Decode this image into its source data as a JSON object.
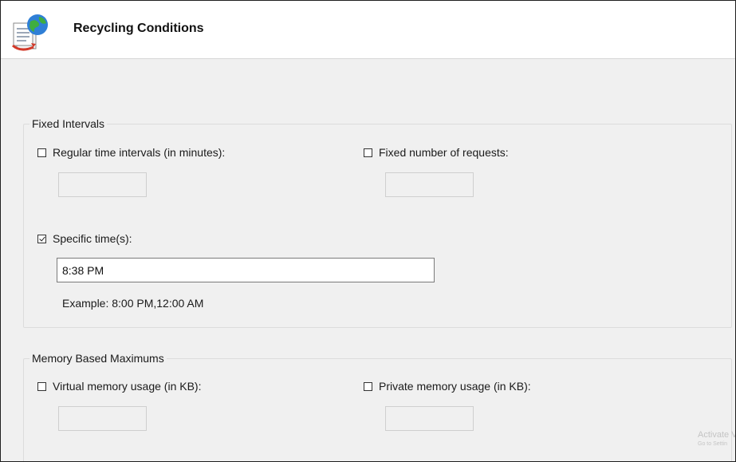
{
  "header": {
    "title": "Recycling Conditions",
    "icon": "application-pool-recycle-icon"
  },
  "fixed_intervals": {
    "legend": "Fixed Intervals",
    "regular_time": {
      "label": "Regular time intervals (in minutes):",
      "checked": false,
      "value": ""
    },
    "fixed_requests": {
      "label": "Fixed number of requests:",
      "checked": false,
      "value": ""
    },
    "specific_times": {
      "label": "Specific time(s):",
      "checked": true,
      "value": "8:38 PM"
    },
    "example": "Example: 8:00 PM,12:00 AM"
  },
  "memory_maximums": {
    "legend": "Memory Based Maximums",
    "virtual_memory": {
      "label": "Virtual memory usage (in KB):",
      "checked": false,
      "value": ""
    },
    "private_memory": {
      "label": "Private memory usage (in KB):",
      "checked": false,
      "value": ""
    }
  },
  "watermark": {
    "line1": "Activate V",
    "line2": "Go to Settin"
  }
}
